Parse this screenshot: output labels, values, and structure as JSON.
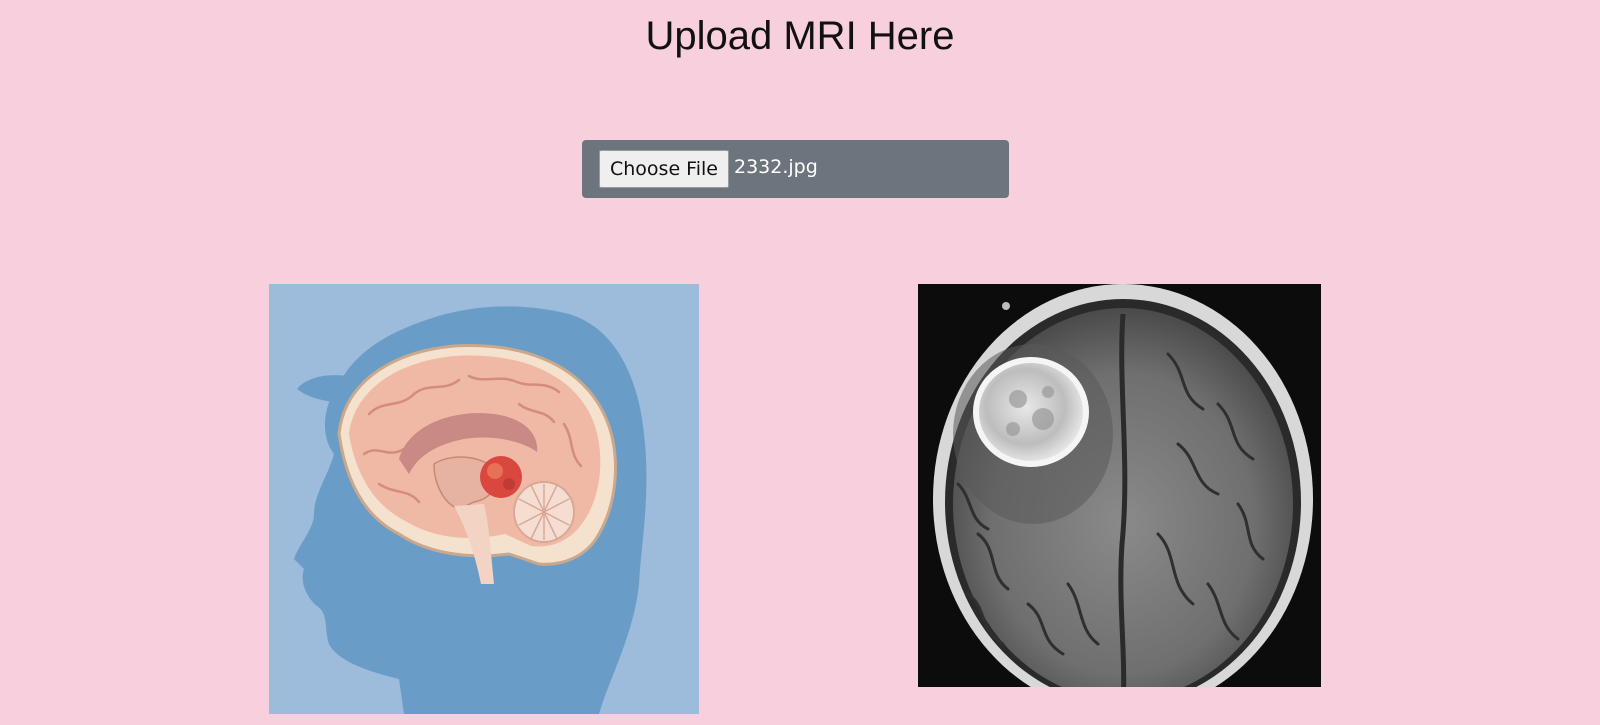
{
  "page": {
    "title": "Upload MRI Here"
  },
  "upload": {
    "button_label": "Choose File",
    "file_name": "2332.jpg"
  },
  "images": {
    "left": {
      "icon": "brain-anatomy-illustration"
    },
    "right": {
      "icon": "brain-mri-scan"
    }
  },
  "colors": {
    "background": "#f8cfdd",
    "upload_bar": "#6c757d",
    "illustration_bg": "#9dbbdb",
    "head_silhouette": "#6a9cc8",
    "brain_tissue": "#f0b9a5",
    "tumor": "#d9473e"
  }
}
